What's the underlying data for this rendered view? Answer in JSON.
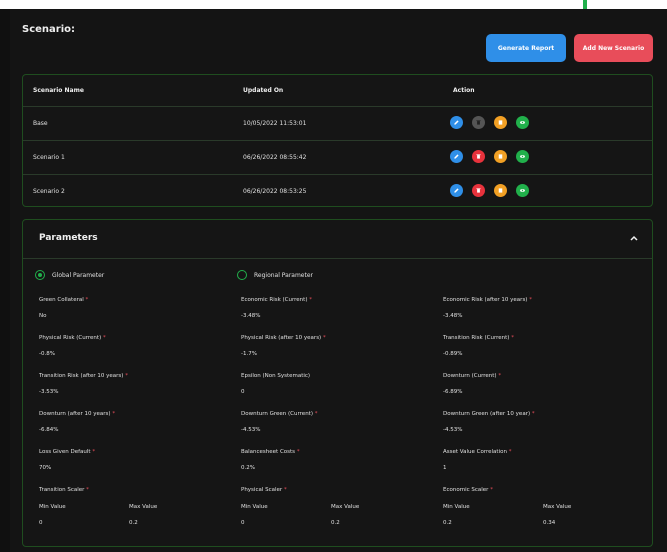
{
  "title": "Scenario:",
  "buttons": {
    "generate_report": "Generate Report",
    "add_new_scenario": "Add New Scenario"
  },
  "table": {
    "headers": [
      "Scenario Name",
      "Updated On",
      "Action"
    ],
    "rows": [
      {
        "name": "Base",
        "updated": "10/05/2022 11:53:01"
      },
      {
        "name": "Scenario 1",
        "updated": "06/26/2022 08:55:42"
      },
      {
        "name": "Scenario 2",
        "updated": "06/26/2022 08:53:25"
      }
    ],
    "action_icons": [
      "edit-icon",
      "delete-icon",
      "copy-icon",
      "view-icon"
    ],
    "colors": {
      "edit": "#2f8fe8",
      "delete": "#e8323c",
      "delete_disabled": "#555555",
      "copy": "#f2a024",
      "view": "#21b04b"
    }
  },
  "parameters": {
    "title": "Parameters",
    "radio": {
      "global": "Global Parameter",
      "regional": "Regional Parameter",
      "selected": "global"
    },
    "fields": [
      {
        "label": "Green Collateral",
        "required": true,
        "value": "No"
      },
      {
        "label": "Economic Risk (Current)",
        "required": true,
        "value": "-3.48%"
      },
      {
        "label": "Economic Risk (after 10 years)",
        "required": true,
        "value": "-3.48%"
      },
      {
        "label": "Physical Risk (Current)",
        "required": true,
        "value": "-0.8%"
      },
      {
        "label": "Physical Risk (after 10 years)",
        "required": true,
        "value": "-1.7%"
      },
      {
        "label": "Transition Risk (Current)",
        "required": true,
        "value": "-0.89%"
      },
      {
        "label": "Transition Risk (after 10 years)",
        "required": true,
        "value": "-3.53%"
      },
      {
        "label": "Epsilon (Non Systematic)",
        "required": false,
        "value": "0"
      },
      {
        "label": "Downturn (Current)",
        "required": true,
        "value": "-6.89%"
      },
      {
        "label": "Downturn (after 10 years)",
        "required": true,
        "value": "-6.84%"
      },
      {
        "label": "Downturn Green (Current)",
        "required": true,
        "value": "-4.53%"
      },
      {
        "label": "Downturn Green (after 10 year)",
        "required": true,
        "value": "-4.53%"
      },
      {
        "label": "Loss Given Default",
        "required": true,
        "value": "70%"
      },
      {
        "label": "Balancesheet Costs",
        "required": true,
        "value": "0.2%"
      },
      {
        "label": "Asset Value Correlation",
        "required": true,
        "value": "1"
      }
    ],
    "scalers": [
      {
        "label": "Transition Scaler",
        "min_label": "Min Value",
        "max_label": "Max Value",
        "min": "0",
        "max": "0.2"
      },
      {
        "label": "Physical Scaler",
        "min_label": "Min Value",
        "max_label": "Max Value",
        "min": "0",
        "max": "0.2"
      },
      {
        "label": "Economic Scaler",
        "min_label": "Min Value",
        "max_label": "Max Value",
        "min": "0.2",
        "max": "0.34"
      }
    ]
  }
}
